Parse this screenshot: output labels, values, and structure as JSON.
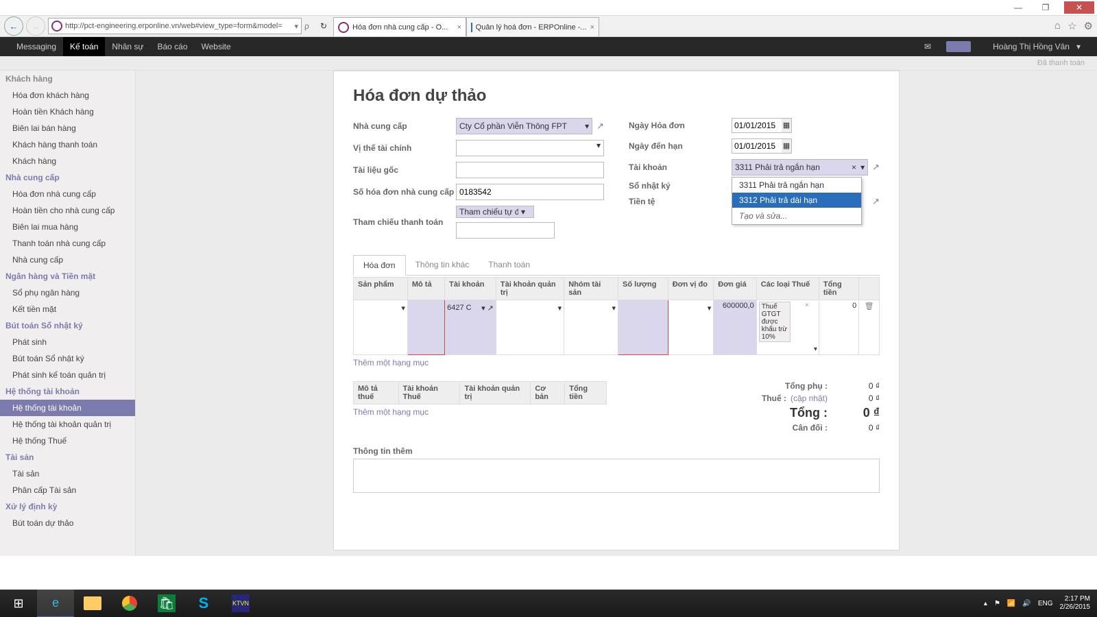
{
  "win": {
    "min": "—",
    "max": "❐",
    "close": "✕"
  },
  "ie": {
    "url": "http://pct-engineering.erponline.vn/web#view_type=form&model=",
    "reload": "↻",
    "tab1": "Hóa đơn nhà cung cấp - O...",
    "tab2": "Quản lý hoá đơn - ERPOnline -...",
    "favhome": "⌂",
    "favstar": "☆",
    "favgear": "⚙"
  },
  "nav": {
    "items": [
      "Messaging",
      "Kế toán",
      "Nhân sự",
      "Báo cáo",
      "Website"
    ],
    "active": 1,
    "user": "Hoàng Thị Hồng Vân"
  },
  "statusRight": "Đã thanh toán",
  "sidebar": {
    "head0": "Khách hàng",
    "items0": [
      "Hóa đơn khách hàng",
      "Hoàn tiền Khách hàng",
      "Biên lai bán hàng",
      "Khách hàng thanh toán",
      "Khách hàng"
    ],
    "head1": "Nhà cung cấp",
    "items1": [
      "Hóa đơn nhà cung cấp",
      "Hoàn tiền cho nhà cung cấp",
      "Biên lai mua hàng",
      "Thanh toán nhà cung cấp",
      "Nhà cung cấp"
    ],
    "head2": "Ngân hàng và Tiền mặt",
    "items2": [
      "Sổ phụ ngân hàng",
      "Kết tiền mặt"
    ],
    "head3": "Bút toán Sổ nhật ký",
    "items3": [
      "Phát sinh",
      "Bút toán Sổ nhật ký",
      "Phát sinh kế toán quản trị"
    ],
    "head4": "Hệ thống tài khoản",
    "items4": [
      "Hệ thống tài khoản",
      "Hệ thống tài khoản quản trị",
      "Hệ thống Thuế"
    ],
    "head5": "Tài sản",
    "items5": [
      "Tài sản",
      "Phân cấp Tài sản"
    ],
    "head6": "Xử lý định kỳ",
    "items6": [
      "Bút toán dự thảo"
    ]
  },
  "form": {
    "title": "Hóa đơn dự thảo",
    "labels": {
      "supplier": "Nhà cung cấp",
      "fiscal": "Vị thế tài chính",
      "source": "Tài liệu gốc",
      "supinv": "Số hóa đơn nhà cung cấp",
      "payref": "Tham chiếu thanh toán",
      "invdate": "Ngày Hóa đơn",
      "duedate": "Ngày đến hạn",
      "account": "Tài khoản",
      "journal": "Sổ nhật ký",
      "currency": "Tiền tệ"
    },
    "supplier": "Cty Cổ phần Viễn Thông FPT",
    "supinv": "0183542",
    "payref": "Tham chiếu tự động",
    "invdate": "01/01/2015",
    "duedate": "01/01/2015",
    "account": "3311 Phải trả ngắn hạn",
    "dd": {
      "o1": "3311 Phải trả ngắn hạn",
      "o2": "3312 Phải trả dài hạn",
      "create": "Tạo và sửa..."
    }
  },
  "tabs": {
    "t1": "Hóa đơn",
    "t2": "Thông tin khác",
    "t3": "Thanh toán"
  },
  "lineCols": {
    "c1": "Sản phẩm",
    "c2": "Mô tả",
    "c3": "Tài khoản",
    "c4": "Tài khoản quản trị",
    "c5": "Nhóm tài sản",
    "c6": "Số lượng",
    "c7": "Đơn vị đo",
    "c8": "Đơn giá",
    "c9": "Các loại Thuế",
    "c10": "Tổng tiền"
  },
  "line": {
    "acct": "6427 C",
    "price": "600000,0",
    "tax": "Thuế GTGT được khấu trừ 10%",
    "total": "0"
  },
  "addline": "Thêm một hạng mục",
  "taxCols": {
    "c1": "Mô tả thuế",
    "c2": "Tài khoản Thuế",
    "c3": "Tài khoản quản trị",
    "c4": "Cơ bản",
    "c5": "Tổng tiền"
  },
  "totals": {
    "sub": "Tổng phụ :",
    "tax": "Thuế :",
    "update": "(cập nhật)",
    "total": "Tổng :",
    "bal": "Cân đối :",
    "v": "0 ₫"
  },
  "addinfo": "Thông tin thêm",
  "tray": {
    "lang": "ENG",
    "time": "2:17 PM",
    "date": "2/26/2015"
  }
}
